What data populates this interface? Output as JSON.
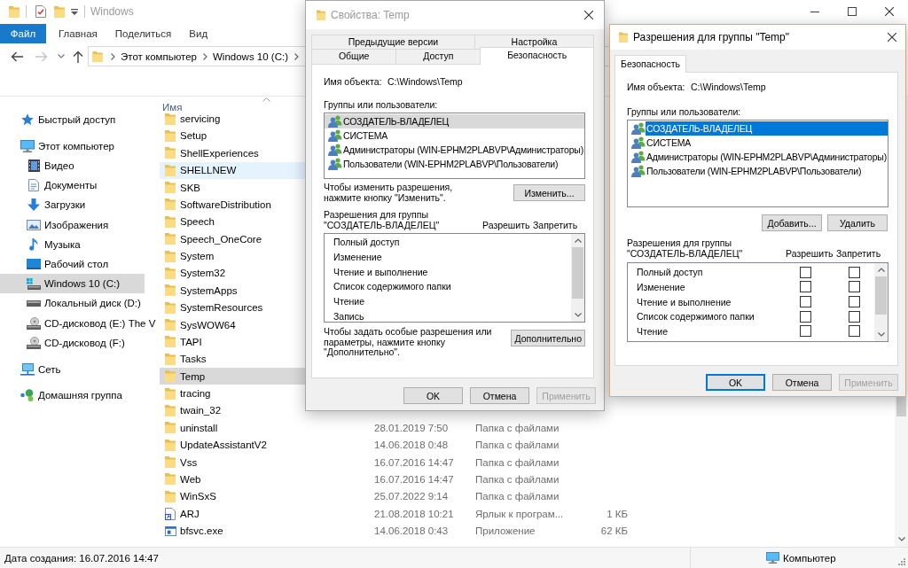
{
  "explorer": {
    "title": "Windows",
    "active": false,
    "ribbon_tabs": [
      {
        "label": "Файл",
        "kind": "file"
      },
      {
        "label": "Главная",
        "kind": "tab"
      },
      {
        "label": "Поделиться",
        "kind": "tab"
      },
      {
        "label": "Вид",
        "kind": "tab"
      }
    ],
    "address": [
      "Этот компьютер",
      "Windows 10 (C:)"
    ],
    "nav": [
      {
        "label": "Быстрый доступ",
        "kind": "quick-access",
        "selected": false
      },
      {
        "label": "Этот компьютер",
        "kind": "computer",
        "selected": false,
        "children": [
          {
            "label": "Видео",
            "kind": "videos",
            "selected": false
          },
          {
            "label": "Документы",
            "kind": "documents",
            "selected": false
          },
          {
            "label": "Загрузки",
            "kind": "downloads",
            "selected": false
          },
          {
            "label": "Изображения",
            "kind": "pictures",
            "selected": false
          },
          {
            "label": "Музыка",
            "kind": "music",
            "selected": false
          },
          {
            "label": "Рабочий стол",
            "kind": "desktop",
            "selected": false
          },
          {
            "label": "Windows 10 (C:)",
            "kind": "system-drive",
            "selected": true
          },
          {
            "label": "Локальный диск (D:)",
            "kind": "drive",
            "selected": false
          },
          {
            "label": "CD-дисковод (E:) The V",
            "kind": "cd-drive",
            "selected": false
          },
          {
            "label": "CD-дисковод (F:)",
            "kind": "cd-drive",
            "selected": false
          }
        ]
      },
      {
        "label": "Сеть",
        "kind": "network",
        "selected": false
      },
      {
        "label": "Домашняя группа",
        "kind": "homegroup",
        "selected": false
      }
    ],
    "columns": [
      {
        "label": "Имя",
        "sorted": true
      }
    ],
    "files": [
      {
        "name": "servicing",
        "kind": "folder",
        "selected": false,
        "hovered": false
      },
      {
        "name": "Setup",
        "kind": "folder",
        "selected": false,
        "hovered": false
      },
      {
        "name": "ShellExperiences",
        "kind": "folder",
        "selected": false,
        "hovered": false
      },
      {
        "name": "SHELLNEW",
        "kind": "folder",
        "selected": false,
        "hovered": true
      },
      {
        "name": "SKB",
        "kind": "folder",
        "selected": false,
        "hovered": false
      },
      {
        "name": "SoftwareDistribution",
        "kind": "folder",
        "selected": false,
        "hovered": false
      },
      {
        "name": "Speech",
        "kind": "folder",
        "selected": false,
        "hovered": false
      },
      {
        "name": "Speech_OneCore",
        "kind": "folder",
        "selected": false,
        "hovered": false
      },
      {
        "name": "System",
        "kind": "folder",
        "selected": false,
        "hovered": false
      },
      {
        "name": "System32",
        "kind": "folder",
        "selected": false,
        "hovered": false
      },
      {
        "name": "SystemApps",
        "kind": "folder",
        "selected": false,
        "hovered": false
      },
      {
        "name": "SystemResources",
        "kind": "folder",
        "selected": false,
        "hovered": false
      },
      {
        "name": "SysWOW64",
        "kind": "folder",
        "selected": false,
        "hovered": false
      },
      {
        "name": "TAPI",
        "kind": "folder",
        "selected": false,
        "hovered": false
      },
      {
        "name": "Tasks",
        "kind": "folder",
        "selected": false,
        "hovered": false
      },
      {
        "name": "Temp",
        "kind": "folder",
        "selected": true,
        "hovered": false
      },
      {
        "name": "tracing",
        "kind": "folder",
        "selected": false,
        "hovered": false
      },
      {
        "name": "twain_32",
        "kind": "folder",
        "selected": false,
        "hovered": false
      },
      {
        "name": "uninstall",
        "kind": "folder",
        "selected": false,
        "hovered": false,
        "date": "28.01.2019 7:50",
        "type": "Папка с файлами"
      },
      {
        "name": "UpdateAssistantV2",
        "kind": "folder",
        "selected": false,
        "hovered": false,
        "date": "14.06.2018 0:48",
        "type": "Папка с файлами"
      },
      {
        "name": "Vss",
        "kind": "folder",
        "selected": false,
        "hovered": false,
        "date": "16.07.2016 14:47",
        "type": "Папка с файлами"
      },
      {
        "name": "Web",
        "kind": "folder",
        "selected": false,
        "hovered": false,
        "date": "16.07.2016 14:47",
        "type": "Папка с файлами"
      },
      {
        "name": "WinSxS",
        "kind": "folder",
        "selected": false,
        "hovered": false,
        "date": "25.07.2022 9:14",
        "type": "Папка с файлами"
      },
      {
        "name": "ARJ",
        "kind": "shortcut",
        "selected": false,
        "hovered": false,
        "date": "21.08.2018 10:21",
        "type": "Ярлык к програм...",
        "size": "1 КБ"
      },
      {
        "name": "bfsvc.exe",
        "kind": "application",
        "selected": false,
        "hovered": false,
        "date": "14.06.2018 0:43",
        "type": "Приложение",
        "size": "62 КБ"
      }
    ],
    "status_bar": {
      "info": "Дата создания: 16.07.2016 14:47",
      "location": "Компьютер"
    }
  },
  "properties_dialog": {
    "title": "Свойства: Temp",
    "active": false,
    "tab_rows": [
      {
        "tabs": [
          {
            "label": "Предыдущие версии",
            "selected": false
          },
          {
            "label": "Настройка",
            "selected": false
          }
        ]
      },
      {
        "tabs": [
          {
            "label": "Общие",
            "selected": false
          },
          {
            "label": "Доступ",
            "selected": false
          },
          {
            "label": "Безопасность",
            "selected": true
          }
        ]
      }
    ],
    "object_label": "Имя объекта:",
    "object_value": "C:\\Windows\\Temp",
    "groups_label": "Группы или пользователи:",
    "groups": [
      {
        "name": "СОЗДАТЕЛЬ-ВЛАДЕЛЕЦ",
        "selected": true
      },
      {
        "name": "СИСТЕМА",
        "selected": false
      },
      {
        "name": "Администраторы (WIN-EPHM2PLABVP\\Администраторы)",
        "selected": false
      },
      {
        "name": "Пользователи (WIN-EPHM2PLABVP\\Пользователи)",
        "selected": false
      }
    ],
    "change_hint": "Чтобы изменить разрешения,\nнажмите кнопку \"Изменить\".",
    "change_button": "Изменить...",
    "permissions_label": "Разрешения для группы\n\"СОЗДАТЕЛЬ-ВЛАДЕЛЕЦ\"",
    "allow_header": "Разрешить",
    "deny_header": "Запретить",
    "permissions": [
      "Полный доступ",
      "Изменение",
      "Чтение и выполнение",
      "Список содержимого папки",
      "Чтение",
      "Запись"
    ],
    "advanced_hint": "Чтобы задать особые разрешения или\nпараметры, нажмите кнопку\n\"Дополнительно\".",
    "advanced_button": "Дополнительно",
    "buttons": [
      {
        "label": "OK",
        "default": false,
        "disabled": false
      },
      {
        "label": "Отмена",
        "default": false,
        "disabled": false
      },
      {
        "label": "Применить",
        "default": false,
        "disabled": true
      }
    ]
  },
  "permissions_dialog": {
    "title": "Разрешения для группы \"Temp\"",
    "active": true,
    "tabs": [
      {
        "label": "Безопасность",
        "selected": true
      }
    ],
    "object_label": "Имя объекта:",
    "object_value": "C:\\Windows\\Temp",
    "groups_label": "Группы или пользователи:",
    "groups": [
      {
        "name": "СОЗДАТЕЛЬ-ВЛАДЕЛЕЦ",
        "selected": true
      },
      {
        "name": "СИСТЕМА",
        "selected": false
      },
      {
        "name": "Администраторы (WIN-EPHM2PLABVP\\Администраторы)",
        "selected": false
      },
      {
        "name": "Пользователи (WIN-EPHM2PLABVP\\Пользователи)",
        "selected": false
      }
    ],
    "group_buttons": [
      "Добавить...",
      "Удалить"
    ],
    "permissions_label": "Разрешения для группы\n\"СОЗДАТЕЛЬ-ВЛАДЕЛЕЦ\"",
    "allow_header": "Разрешить",
    "deny_header": "Запретить",
    "permissions": [
      {
        "name": "Полный доступ",
        "allow": false,
        "deny": false
      },
      {
        "name": "Изменение",
        "allow": false,
        "deny": false
      },
      {
        "name": "Чтение и выполнение",
        "allow": false,
        "deny": false
      },
      {
        "name": "Список содержимого папки",
        "allow": false,
        "deny": false
      },
      {
        "name": "Чтение",
        "allow": false,
        "deny": false
      }
    ],
    "buttons": [
      {
        "label": "OK",
        "default": true,
        "disabled": false
      },
      {
        "label": "Отмена",
        "default": false,
        "disabled": false
      },
      {
        "label": "Применить",
        "default": false,
        "disabled": true
      }
    ]
  }
}
